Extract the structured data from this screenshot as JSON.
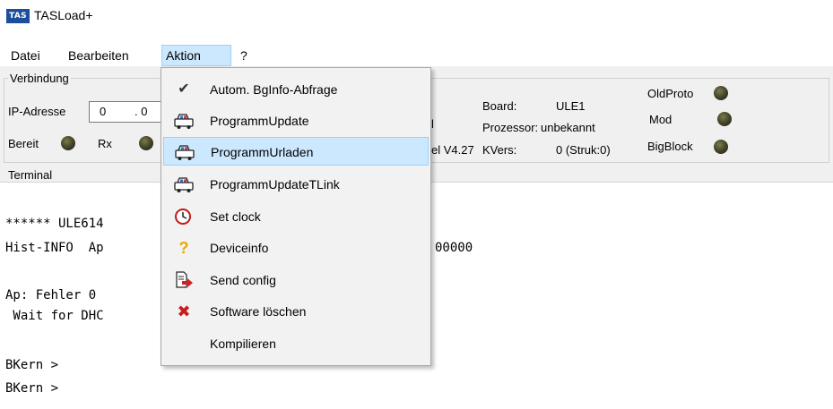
{
  "window": {
    "title": "TASLoad+",
    "icon_label": "TAS"
  },
  "menubar": {
    "items": [
      "Datei",
      "Bearbeiten",
      "Aktion",
      "?"
    ],
    "active": "Aktion"
  },
  "connection": {
    "group_label": "Verbindung",
    "ip_label": "IP-Adresse",
    "ip_seg1": "0",
    "ip_seg2": ". 0",
    "ready_label": "Bereit",
    "rx_label": "Rx",
    "fragment_char": "l",
    "fragment_version": "el V4.27",
    "board_label": "Board:",
    "board_value": "ULE1",
    "processor_label": "Prozessor:",
    "processor_value": "unbekannt",
    "kvers_label": "KVers:",
    "kvers_value": "0 (Struk:0)",
    "oldproto_label": "OldProto",
    "mod_label": "Mod",
    "bigblock_label": "BigBlock"
  },
  "terminal": {
    "label": "Terminal",
    "lines": [
      "****** ULE614",
      "Hist-INFO  Ap",
      "00000",
      "Ap: Fehler 0",
      " Wait for DHC",
      "BKern >",
      "BKern >"
    ]
  },
  "dropdown": {
    "items": [
      {
        "label": "Autom. BgInfo-Abfrage",
        "icon": "checkmark-icon",
        "checked": true
      },
      {
        "label": "ProgrammUpdate",
        "icon": "vehicle-update-icon"
      },
      {
        "label": "ProgrammUrladen",
        "icon": "vehicle-upload-icon",
        "highlighted": true
      },
      {
        "label": "ProgrammUpdateTLink",
        "icon": "vehicle-tlink-icon"
      },
      {
        "label": "Set clock",
        "icon": "clock-icon"
      },
      {
        "label": "Deviceinfo",
        "icon": "question-icon"
      },
      {
        "label": "Send config",
        "icon": "send-document-icon"
      },
      {
        "label": "Software löschen",
        "icon": "delete-x-icon"
      },
      {
        "label": "Kompilieren",
        "icon": ""
      }
    ]
  },
  "colors": {
    "highlight": "#cce8ff",
    "highlight_border": "#99d1ff",
    "app_icon": "#1b4f9c"
  }
}
